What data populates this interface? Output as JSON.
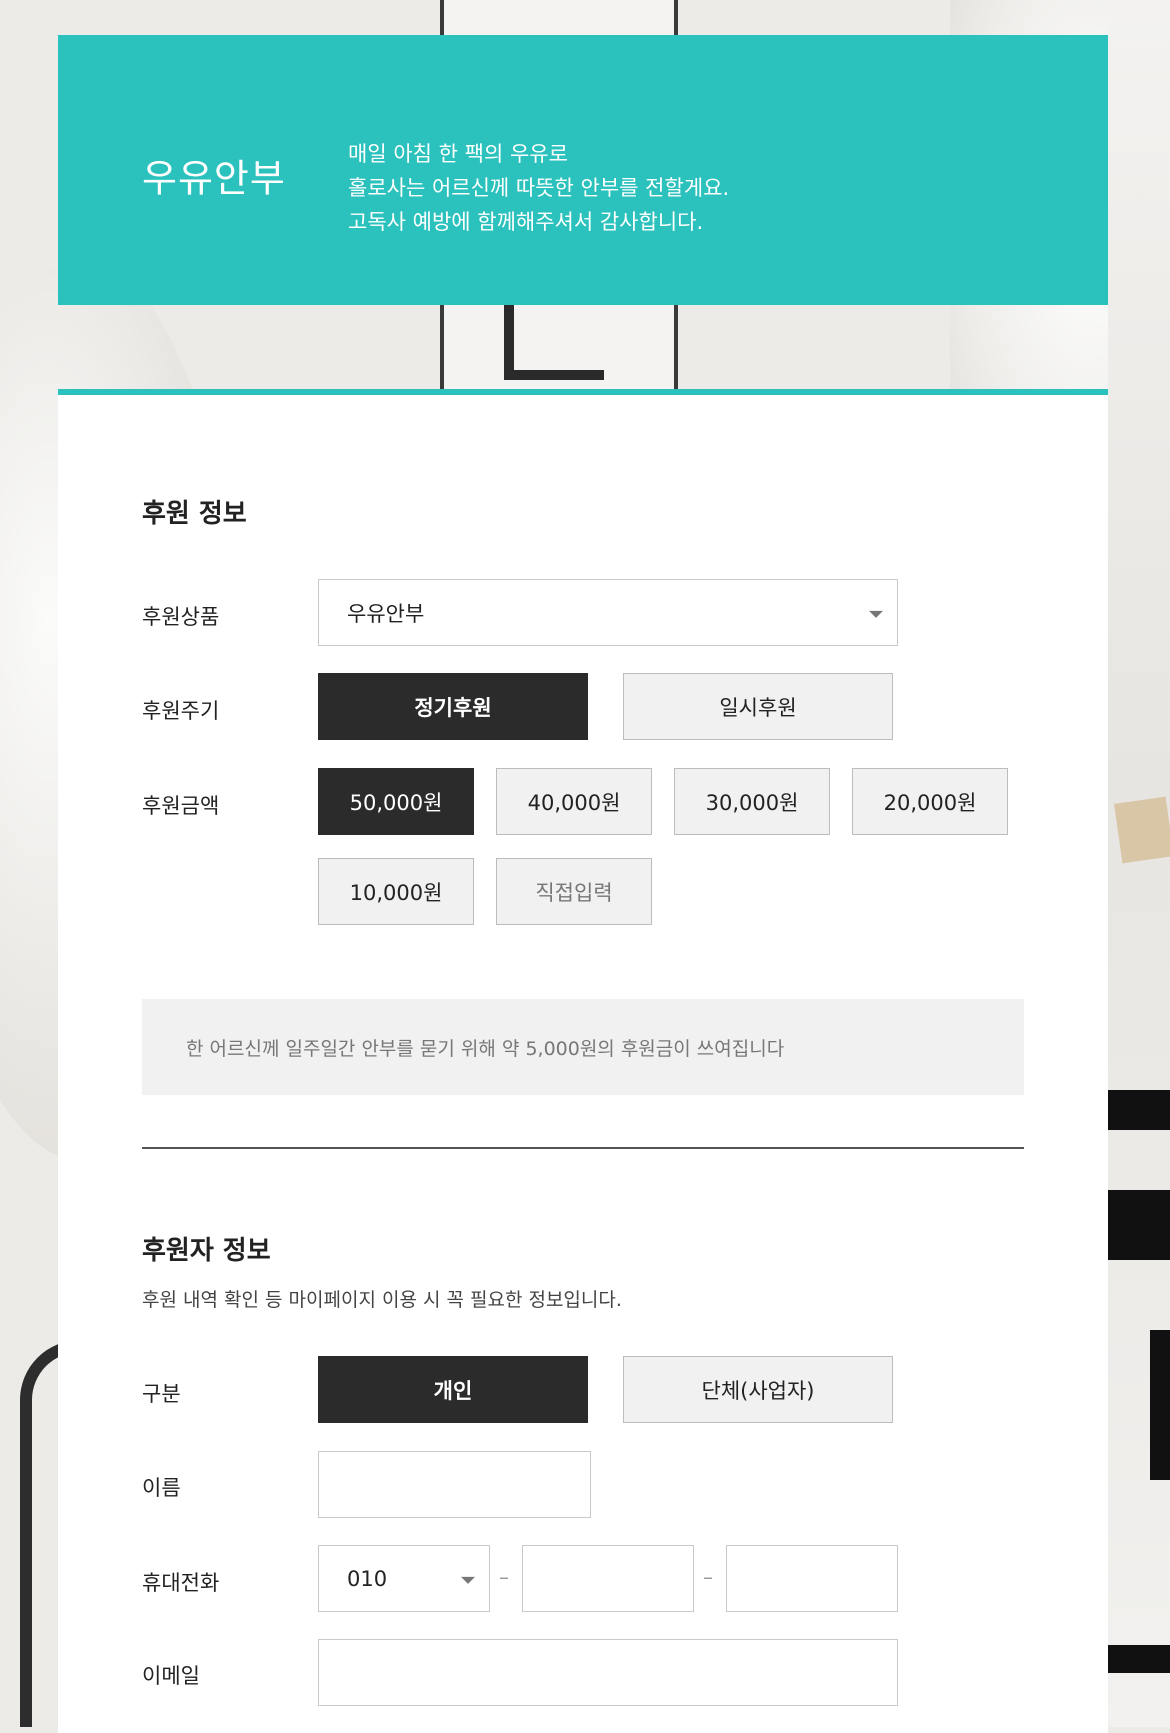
{
  "hero": {
    "title": "우유안부",
    "lines": [
      "매일 아침 한 팩의 우유로",
      "홀로사는 어르신께 따뜻한 안부를 전할게요.",
      "고독사 예방에 함께해주셔서 감사합니다."
    ]
  },
  "donation": {
    "title": "후원 정보",
    "product_label": "후원상품",
    "product_value": "우유안부",
    "cycle_label": "후원주기",
    "cycle_options": [
      "정기후원",
      "일시후원"
    ],
    "cycle_selected": "정기후원",
    "amount_label": "후원금액",
    "amounts": [
      "50,000원",
      "40,000원",
      "30,000원",
      "20,000원",
      "10,000원",
      "직접입력"
    ],
    "amount_selected": "50,000원",
    "notice": "한 어르신께 일주일간 안부를 묻기 위해 약 5,000원의 후원금이 쓰여집니다"
  },
  "donor": {
    "title": "후원자 정보",
    "description": "후원 내역 확인 등 마이페이지 이용 시 꼭 필요한 정보입니다.",
    "type_label": "구분",
    "type_options": [
      "개인",
      "단체(사업자)"
    ],
    "type_selected": "개인",
    "name_label": "이름",
    "phone_label": "휴대전화",
    "phone_prefix": "010",
    "phone_separator": "–",
    "email_label": "이메일"
  },
  "colors": {
    "accent": "#2bc1bd",
    "active_button": "#2b2b2b",
    "inactive_button": "#f1f1f1"
  }
}
